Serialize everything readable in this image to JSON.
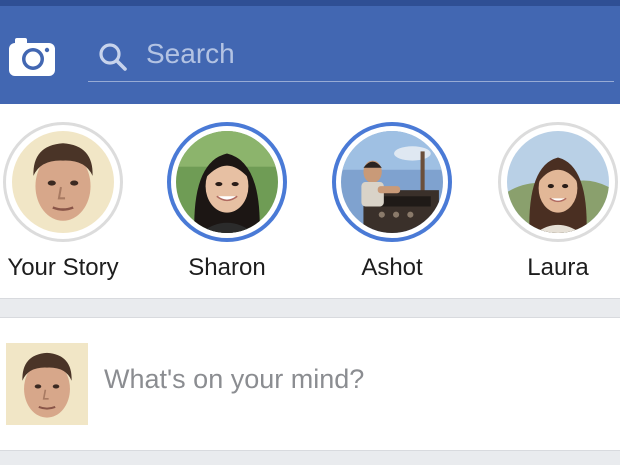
{
  "colors": {
    "topbar": "#4267b2",
    "status_strip": "#2f4f94",
    "unseen_ring": "#4a7ad6",
    "seen_ring": "#dcdcdc",
    "divider": "#e9ebee",
    "placeholder": "#8b8d91"
  },
  "header": {
    "camera_icon": "camera-icon",
    "search_icon": "search-icon",
    "search_placeholder": "Search"
  },
  "stories": [
    {
      "name": "Your Story",
      "seen": true
    },
    {
      "name": "Sharon",
      "seen": false
    },
    {
      "name": "Ashot",
      "seen": false
    },
    {
      "name": "Laura",
      "seen": true
    }
  ],
  "composer": {
    "placeholder": "What's on your mind?"
  }
}
